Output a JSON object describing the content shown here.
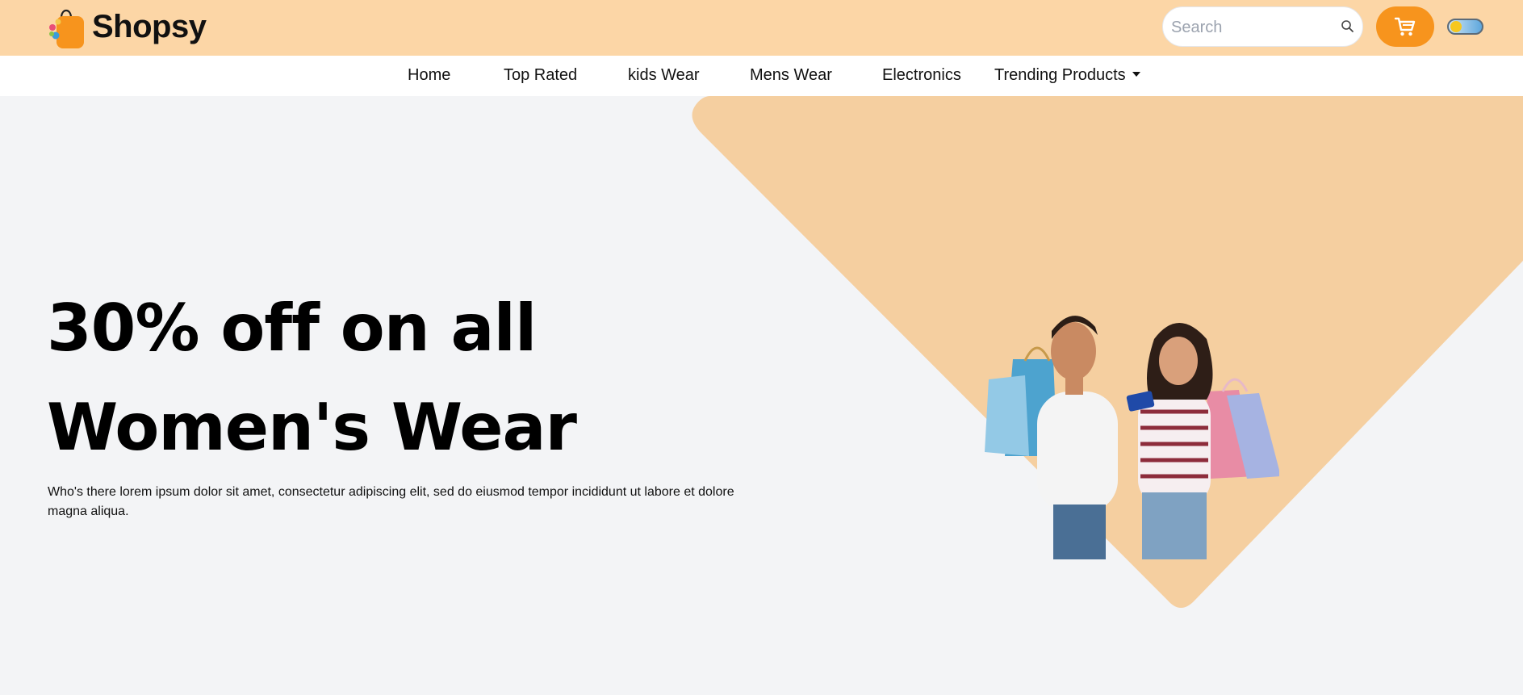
{
  "brand": {
    "name": "Shopsy",
    "accent": "#f7941d",
    "topbar_bg": "#fcd6a6",
    "shape_color": "#f5cfa0"
  },
  "header": {
    "search": {
      "placeholder": "Search",
      "value": ""
    },
    "icons": [
      "search-icon",
      "cart-icon",
      "theme-toggle"
    ]
  },
  "nav": {
    "items": [
      {
        "label": "Home"
      },
      {
        "label": "Top Rated"
      },
      {
        "label": "kids Wear"
      },
      {
        "label": "Mens Wear"
      },
      {
        "label": "Electronics"
      },
      {
        "label": "Trending Products"
      }
    ]
  },
  "hero": {
    "title_line1": "30% off on all",
    "title_line2": "Women's Wear",
    "text": "Who's there lorem ipsum dolor sit amet, consectetur adipiscing elit, sed do eiusmod tempor incididunt ut labore et dolore magna aliqua."
  }
}
